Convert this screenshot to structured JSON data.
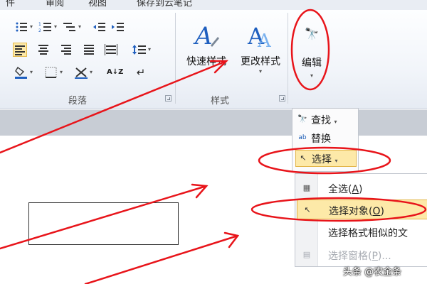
{
  "menubar": {
    "tabs": [
      {
        "label": "件"
      },
      {
        "label": "审阅"
      },
      {
        "label": "视图"
      },
      {
        "label": "保存到云笔记"
      }
    ]
  },
  "ribbon": {
    "paragraph": {
      "label": "段落",
      "sort_glyph": "A↓Z",
      "linebreak_glyph": "↵"
    },
    "styles": {
      "label": "样式",
      "quick_styles": {
        "label": "快速样式",
        "glyph": "A"
      },
      "change_styles": {
        "label": "更改样式",
        "glyph": "A"
      }
    },
    "editing": {
      "label": "编辑",
      "icon_glyph": "🔭"
    }
  },
  "edit_menu": {
    "find": {
      "label": "查找",
      "icon": "binoculars-icon",
      "glyph": "🔭"
    },
    "replace": {
      "label": "替换",
      "icon": "replace-icon",
      "glyph": "ab"
    },
    "select": {
      "label": "选择",
      "icon": "cursor-icon",
      "glyph": "↖"
    }
  },
  "select_submenu": {
    "select_all": {
      "label": "全选(",
      "key": "A",
      "end": ")",
      "glyph": "▦"
    },
    "select_objects": {
      "label": "选择对象(",
      "key": "O",
      "end": ")",
      "glyph": "↖"
    },
    "select_similar": {
      "label": "选择格式相似的文"
    },
    "selection_pane": {
      "label": "选择窗格(",
      "key": "P",
      "end": ")...",
      "glyph": "▤"
    }
  },
  "watermark": "头条 @农金条",
  "colors": {
    "annotation": "#e8141a",
    "highlight": "#fde9a8",
    "highlight_border": "#e3b64a",
    "ribbon_blue": "#1f5fbf"
  }
}
